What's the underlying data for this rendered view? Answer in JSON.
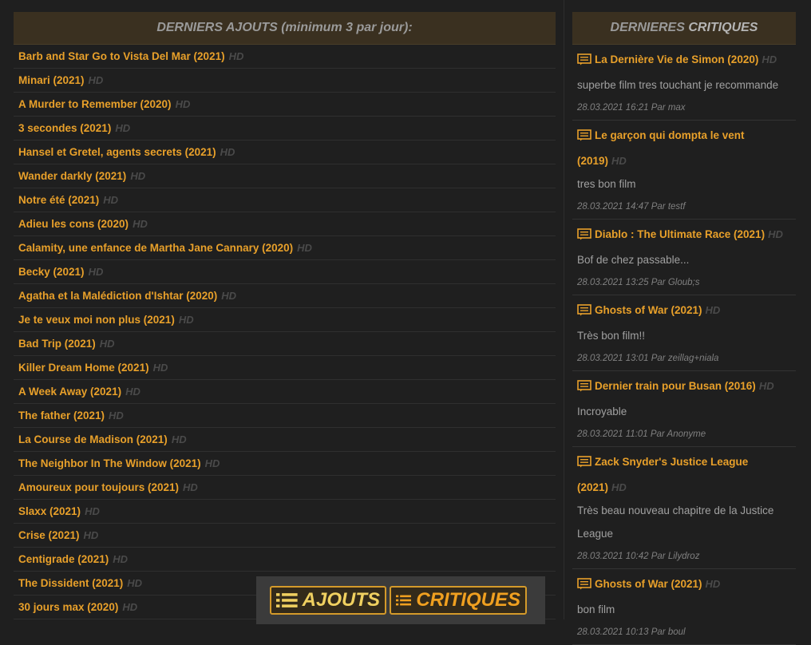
{
  "left_panel": {
    "header": {
      "prefix": "DERNIERS AJOUTS",
      "suffix": "(minimum 3 par jour):"
    },
    "hd_label": "HD",
    "movies": [
      "Barb and Star Go to Vista Del Mar (2021)",
      "Minari (2021)",
      "A Murder to Remember (2020)",
      "3 secondes (2021)",
      "Hansel et Gretel, agents secrets (2021)",
      "Wander darkly (2021)",
      "Notre été (2021)",
      "Adieu les cons (2020)",
      "Calamity, une enfance de Martha Jane Cannary (2020)",
      "Becky (2021)",
      "Agatha et la Malédiction d'Ishtar (2020)",
      "Je te veux moi non plus (2021)",
      "Bad Trip (2021)",
      "Killer Dream Home (2021)",
      "A Week Away (2021)",
      "The father (2021)",
      "La Course de Madison (2021)",
      "The Neighbor In The Window (2021)",
      "Amoureux pour toujours (2021)",
      "Slaxx (2021)",
      "Crise (2021)",
      "Centigrade (2021)",
      "The Dissident (2021)",
      "30 jours max (2020)"
    ]
  },
  "right_panel": {
    "header": {
      "prefix": "DERNIERES",
      "suffix": "CRITIQUES"
    },
    "hd_label": "HD",
    "reviews": [
      {
        "title": "La Dernière Vie de Simon (2020)",
        "text": "superbe film tres touchant je recommande",
        "meta": "28.03.2021 16:21 Par max"
      },
      {
        "title": "Le garçon qui dompta le vent (2019)",
        "text": "tres bon film",
        "meta": "28.03.2021 14:47 Par testf"
      },
      {
        "title": "Diablo : The Ultimate Race (2021)",
        "text": "Bof de chez passable...",
        "meta": "28.03.2021 13:25 Par Gloub;s"
      },
      {
        "title": "Ghosts of War (2021)",
        "text": "Très bon film!!",
        "meta": "28.03.2021 13:01 Par zeillag+niala"
      },
      {
        "title": "Dernier train pour Busan (2016)",
        "text": "Incroyable",
        "meta": "28.03.2021 11:01 Par Anonyme"
      },
      {
        "title": "Zack Snyder's Justice League (2021)",
        "text": "Très beau nouveau chapitre de la Justice League",
        "meta": "28.03.2021 10:42 Par Lilydroz"
      },
      {
        "title": "Ghosts of War (2021)",
        "text": "bon film",
        "meta": "28.03.2021 10:13 Par boul"
      }
    ]
  },
  "bottom_bar": {
    "ajouts_label": "AJOUTS",
    "critiques_label": "CRITIQUES"
  },
  "colors": {
    "accent": "#e8a02a",
    "header_bg": "#3a3020",
    "page_bg": "#1f1f1f",
    "hd": "#4a4a4a"
  },
  "icons": {
    "review": "comment-icon",
    "tab": "list-icon"
  }
}
